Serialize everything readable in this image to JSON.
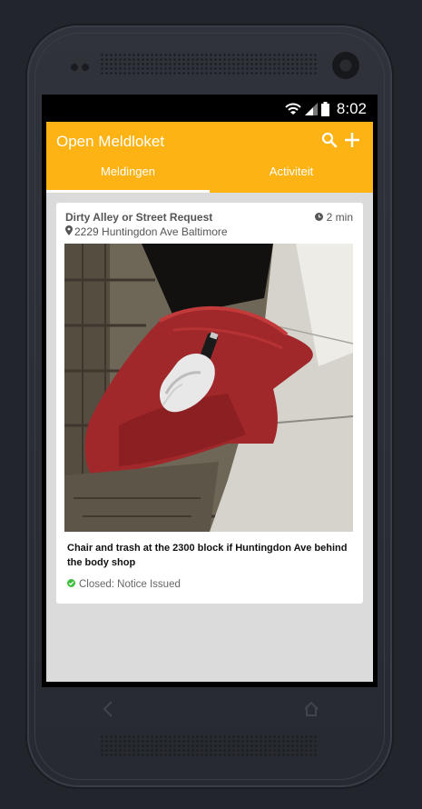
{
  "statusbar": {
    "time": "8:02",
    "icons": [
      "wifi-icon",
      "signal-icon",
      "battery-icon"
    ]
  },
  "app": {
    "title": "Open Meldloket",
    "actions": [
      "search-icon",
      "add-icon"
    ],
    "tabs": [
      {
        "label": "Meldingen",
        "selected": true
      },
      {
        "label": "Activiteit",
        "selected": false
      }
    ],
    "accent_color": "#fdb313"
  },
  "report": {
    "title": "Dirty Alley or Street Request",
    "time": "2 min",
    "address": "2229 Huntingdon Ave Baltimore",
    "photo_alt": "photo",
    "description": "Chair and trash at the 2300 block if Huntingdon Ave behind the body shop",
    "status": "Closed: Notice Issued",
    "status_color": "#3fbf3f"
  }
}
